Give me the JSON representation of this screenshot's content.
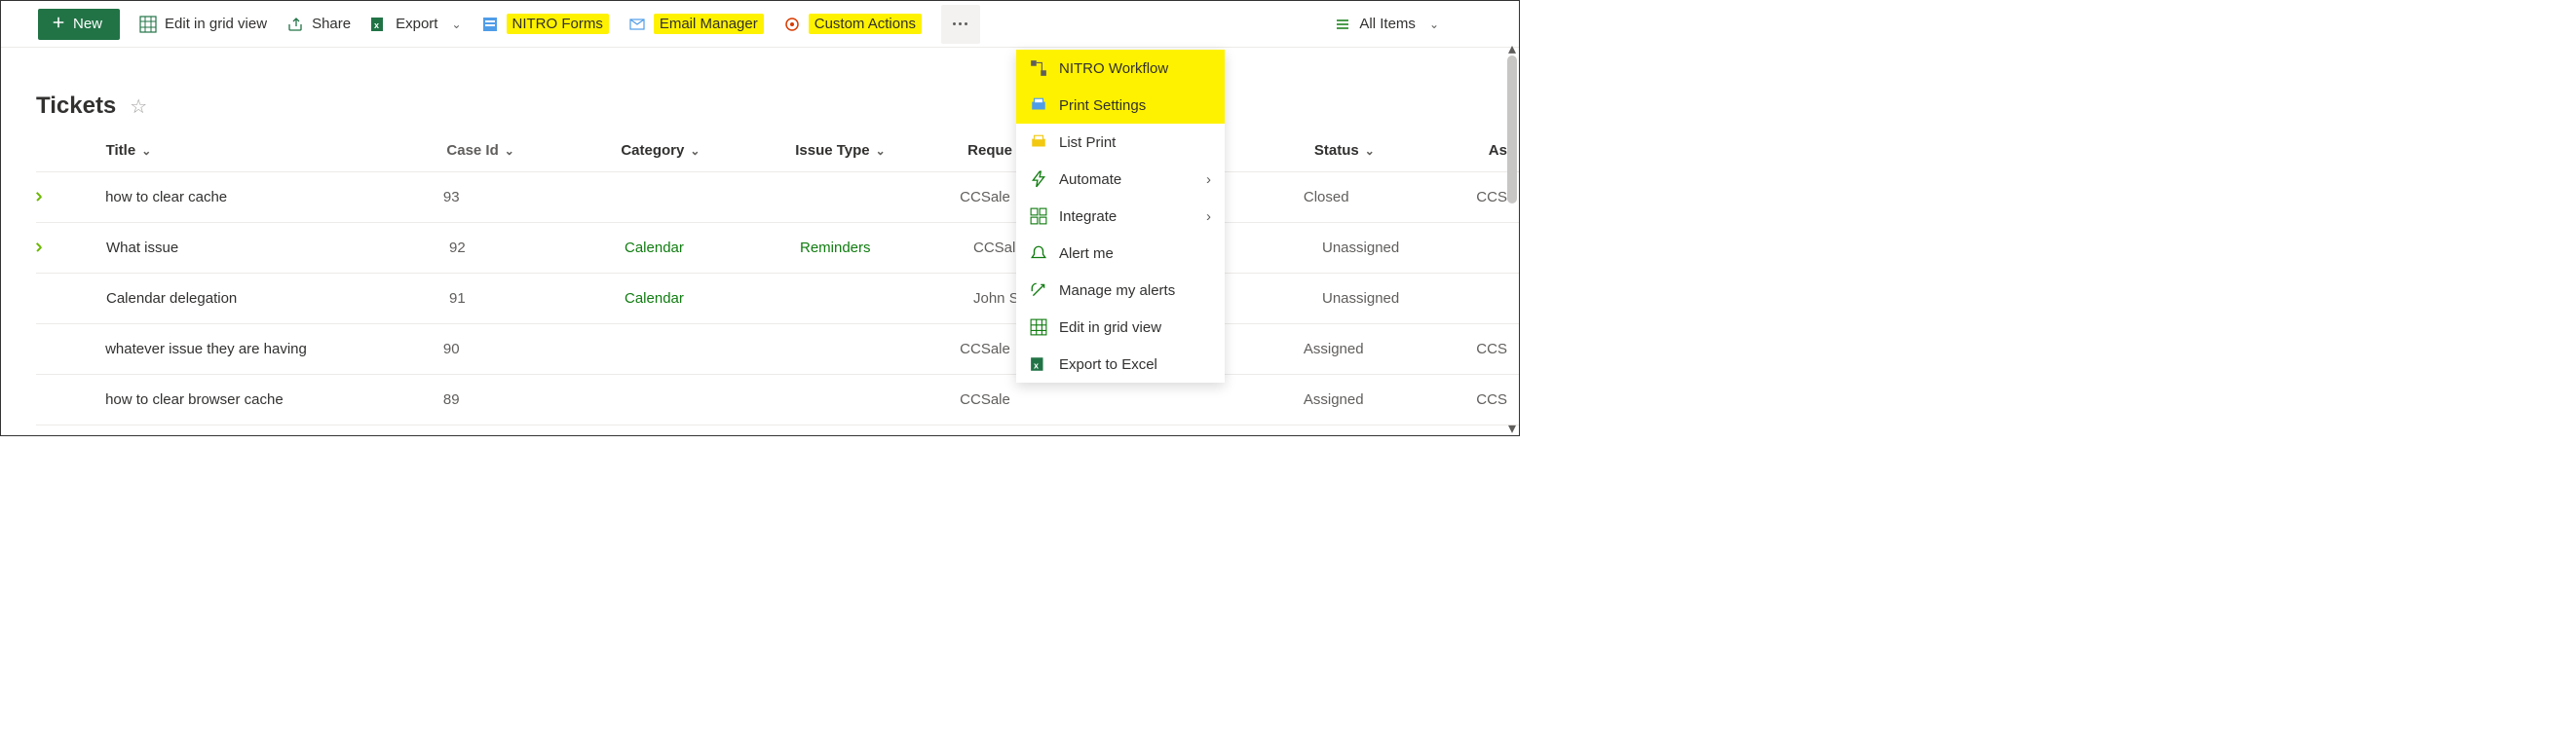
{
  "toolbar": {
    "new_label": "New",
    "edit_grid_label": "Edit in grid view",
    "share_label": "Share",
    "export_label": "Export",
    "nitro_forms_label": "NITRO Forms",
    "email_mgr_label": "Email Manager",
    "custom_actions_label": "Custom Actions",
    "view_label": "All Items"
  },
  "dropdown": {
    "items": [
      {
        "label": "NITRO Workflow",
        "hl": true,
        "icon": "workflow-icon"
      },
      {
        "label": "Print Settings",
        "hl": true,
        "icon": "print-settings-icon"
      },
      {
        "label": "List Print",
        "icon": "list-print-icon"
      },
      {
        "label": "Automate",
        "icon": "automate-icon",
        "sub": true
      },
      {
        "label": "Integrate",
        "icon": "integrate-icon",
        "sub": true
      },
      {
        "label": "Alert me",
        "icon": "alert-icon"
      },
      {
        "label": "Manage my alerts",
        "icon": "manage-alerts-icon"
      },
      {
        "label": "Edit in grid view",
        "icon": "grid-icon"
      },
      {
        "label": "Export to Excel",
        "icon": "excel-icon"
      }
    ]
  },
  "page": {
    "title": "Tickets"
  },
  "columns": {
    "title": "Title",
    "caseid": "Case Id",
    "category": "Category",
    "issuetype": "Issue Type",
    "requester": "Reque",
    "status": "Status",
    "assigned": "As"
  },
  "rows": [
    {
      "new": true,
      "title": "how to clear cache",
      "caseid": "93",
      "category": "",
      "issuetype": "",
      "requester": "CCSale",
      "status": "Closed",
      "assigned": "CCS"
    },
    {
      "new": true,
      "title": "What issue",
      "caseid": "92",
      "category": "Calendar",
      "issuetype": "Reminders",
      "requester": "CCSale",
      "status": "Unassigned",
      "assigned": ""
    },
    {
      "new": false,
      "title": "Calendar delegation",
      "caseid": "91",
      "category": "Calendar",
      "issuetype": "",
      "requester": "John Sm",
      "status": "Unassigned",
      "assigned": ""
    },
    {
      "new": false,
      "title": "whatever issue they are having",
      "caseid": "90",
      "category": "",
      "issuetype": "",
      "requester": "CCSale",
      "status": "Assigned",
      "assigned": "CCS"
    },
    {
      "new": false,
      "title": "how to clear browser cache",
      "caseid": "89",
      "category": "",
      "issuetype": "",
      "requester": "CCSale",
      "status": "Assigned",
      "assigned": "CCS"
    }
  ]
}
